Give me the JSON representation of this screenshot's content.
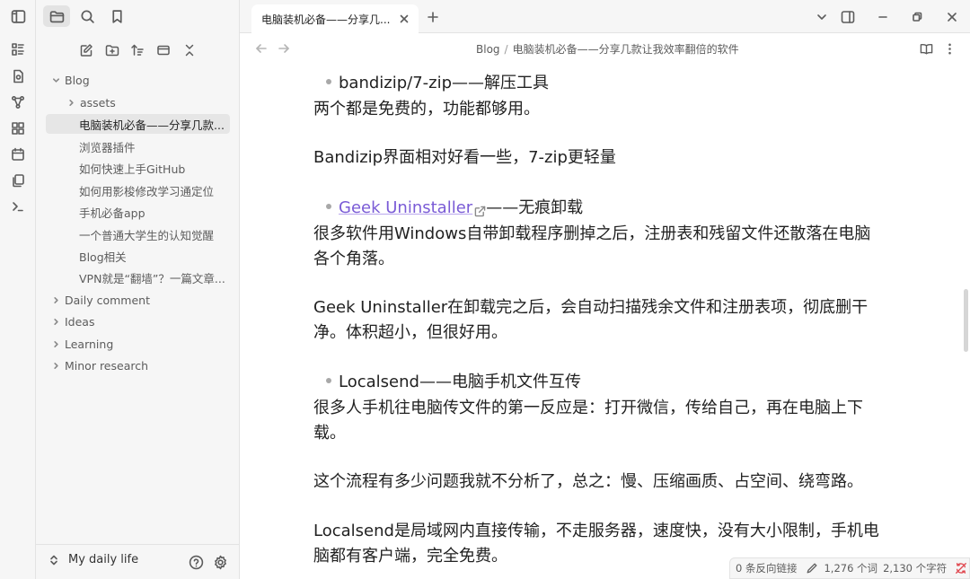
{
  "window": {
    "colors": {
      "accent": "#7a5bd6",
      "sidebar_bg": "#f6f6f6",
      "selected_bg": "#e6e6e6",
      "sync_error": "#e0464e"
    }
  },
  "top_icons": [
    "sidebar-toggle-icon",
    "folder-icon",
    "search-icon",
    "bookmark-icon"
  ],
  "ribbon": [
    "switcher-icon",
    "daily-note-icon",
    "graph-icon",
    "canvas-icon",
    "calendar-icon",
    "templates-icon",
    "terminal-icon"
  ],
  "nav_toolbar": [
    "new-note-icon",
    "new-folder-icon",
    "sort-icon",
    "collapse-icon",
    "close-all-icon"
  ],
  "tree": {
    "blog": {
      "label": "Blog",
      "expanded": true
    },
    "blog_children": [
      {
        "label": "assets",
        "type": "folder"
      },
      {
        "label": "电脑装机必备——分享几款...",
        "type": "file",
        "selected": true
      },
      {
        "label": "浏览器插件",
        "type": "file"
      },
      {
        "label": "如何快速上手GitHub",
        "type": "file"
      },
      {
        "label": "如何用影梭修改学习通定位",
        "type": "file"
      },
      {
        "label": "手机必备app",
        "type": "file"
      },
      {
        "label": "一个普通大学生的认知觉醒",
        "type": "file"
      },
      {
        "label": "Blog相关",
        "type": "file"
      },
      {
        "label": "VPN就是“翻墙”？一篇文章...",
        "type": "file"
      }
    ],
    "root_folders": [
      {
        "label": "Daily comment"
      },
      {
        "label": "Ideas"
      },
      {
        "label": "Learning"
      },
      {
        "label": "Minor research"
      }
    ]
  },
  "footer": {
    "vault_name": "My daily life"
  },
  "tab": {
    "title": "电脑装机必备——分享几..."
  },
  "breadcrumb": {
    "folder": "Blog",
    "separator": "/",
    "file": "电脑装机必备——分享几款让我效率翻倍的软件"
  },
  "document": {
    "b1": "bandizip/7-zip——解压工具",
    "p1": "两个都是免费的，功能都够用。",
    "p2": "Bandizip界面相对好看一些，7-zip更轻量",
    "b2_link": "Geek Uninstaller",
    "b2_rest": "——无痕卸载",
    "p3a": "很多软件用Windows自带卸载程序删掉之后，注册表和残留文件还散落在电脑",
    "p3b": "各个角落。",
    "p4a": "Geek Uninstaller在卸载完之后，会自动扫描残余文件和注册表项，彻底删干",
    "p4b": "净。体积超小，但很好用。",
    "b3": "Localsend——电脑手机文件互传",
    "p5a": "很多人手机往电脑传文件的第一反应是：打开微信，传给自己，再在电脑上下",
    "p5b": "载。",
    "p6": "这个流程有多少问题我就不分析了，总之：慢、压缩画质、占空间、绕弯路。",
    "p7a": "Localsend是局域网内直接传输，不走服务器，速度快，没有大小限制，手机电",
    "p7b": "脑都有客户端，完全免费。"
  },
  "status": {
    "backlinks": "0 条反向链接",
    "words": "1,276 个词",
    "chars": "2,130 个字符"
  }
}
